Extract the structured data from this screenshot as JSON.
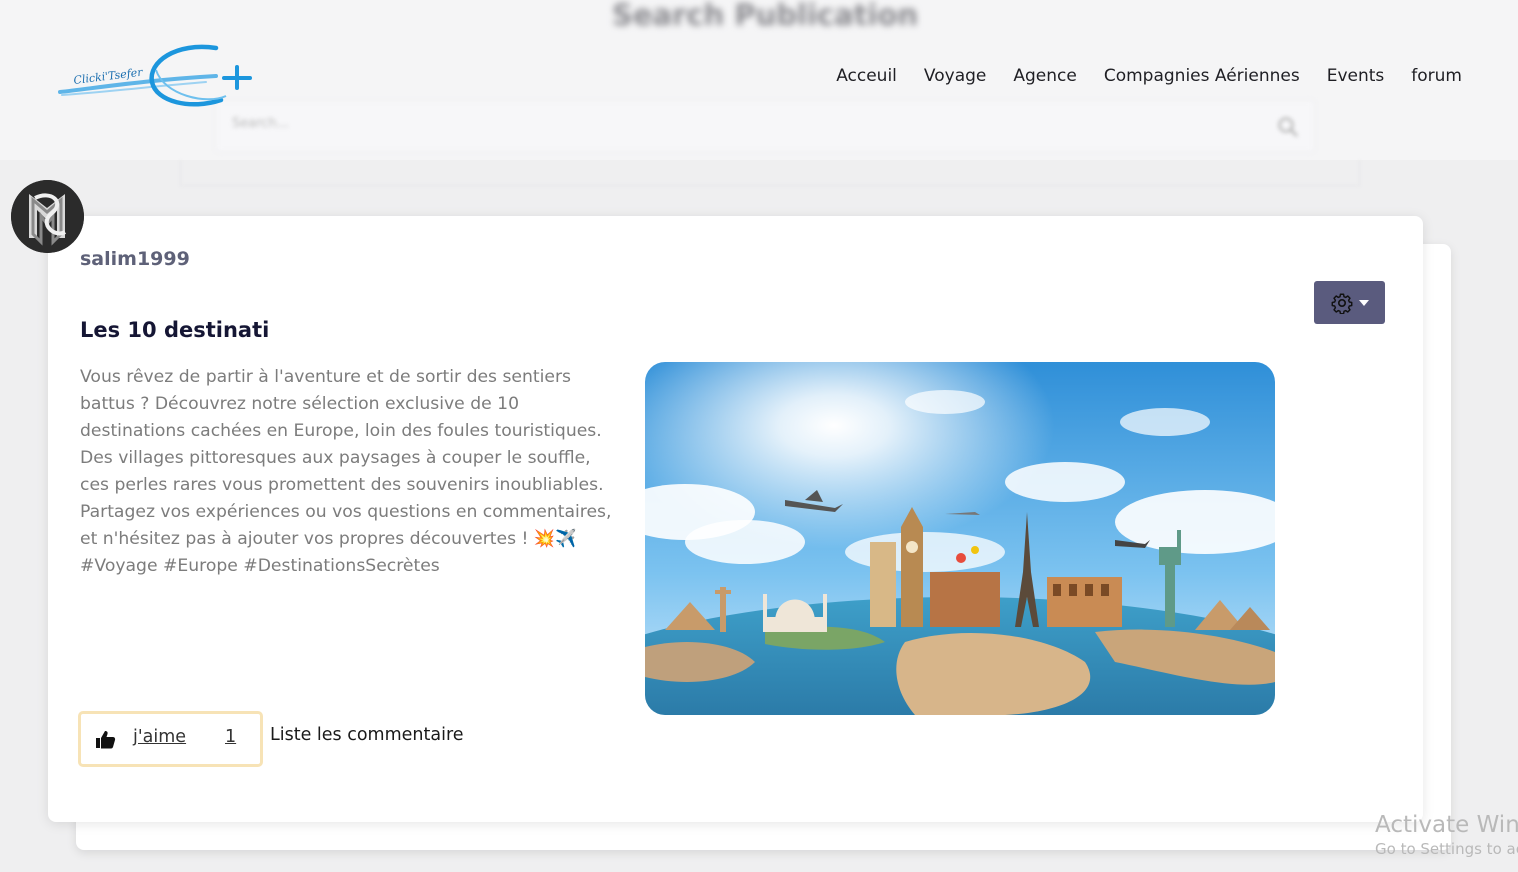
{
  "header": {
    "page_heading": "Search Publication",
    "search_placeholder": "Search...",
    "logo_text": "Clicki'Tsefer"
  },
  "nav": {
    "items": [
      {
        "label": "Acceuil"
      },
      {
        "label": "Voyage"
      },
      {
        "label": "Agence"
      },
      {
        "label": "Compagnies Aériennes"
      },
      {
        "label": "Events"
      },
      {
        "label": "forum"
      }
    ]
  },
  "post": {
    "username": "salim1999",
    "title": "Les 10 destinati",
    "body": "Vous rêvez de partir à l'aventure et de sortir des sentiers battus ? Découvrez notre sélection exclusive de 10 destinations cachées en Europe, loin des foules touristiques. Des villages pittoresques aux paysages à couper le souffle, ces perles rares vous promettent des souvenirs inoubliables. Partagez vos expériences ou vos questions en commentaires, et n'hésitez pas à ajouter vos propres découvertes ! 💥✈️ #Voyage #Europe #DestinationsSecrètes",
    "like_label": "j'aime",
    "like_count": "1",
    "comments_label": "Liste les commentaire",
    "settings_icon": "gear-icon"
  },
  "watermark": {
    "line1": "Activate Windows",
    "line2": "Go to Settings to activate Windows."
  },
  "colors": {
    "settings_button": "#5a5b7e",
    "like_border": "#f7e3b6",
    "username": "#5e6178"
  }
}
